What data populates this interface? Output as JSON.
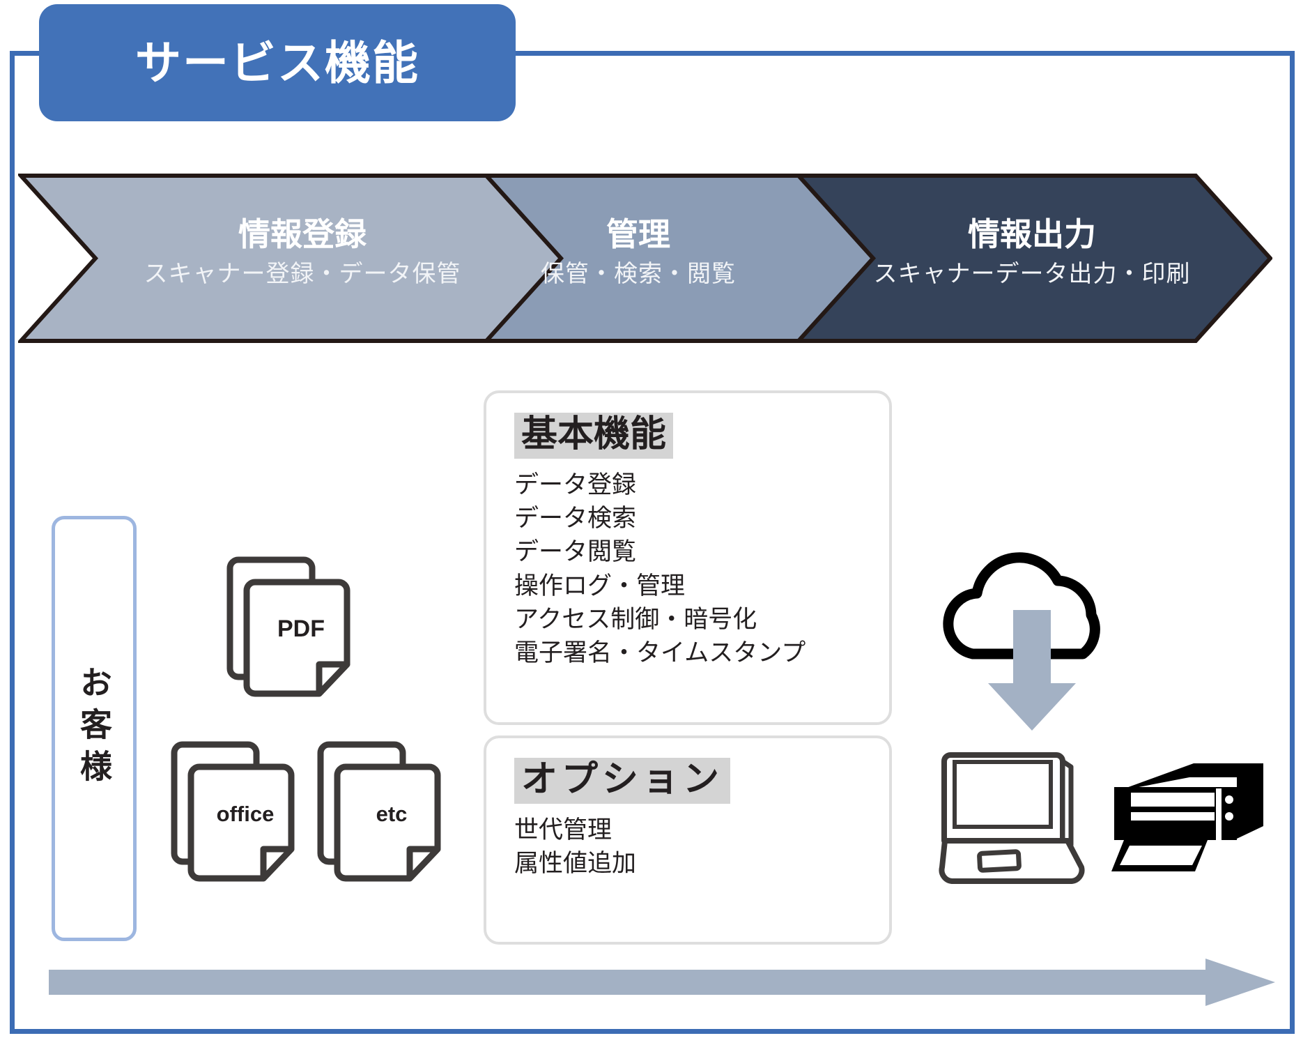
{
  "title_tab": {
    "label": "サービス機能"
  },
  "process_flow": {
    "steps": [
      {
        "title": "情報登録",
        "subtitle": "スキャナー登録・データ保管",
        "color": "#a8b3c4"
      },
      {
        "title": "管理",
        "subtitle": "保管・検索・閲覧",
        "color": "#8b9cb5"
      },
      {
        "title": "情報出力",
        "subtitle": "スキャナーデータ出力・印刷",
        "color": "#35435a"
      }
    ]
  },
  "customer": {
    "label": "お客様",
    "border_color": "#9db6e0"
  },
  "documents": [
    {
      "label": "PDF",
      "name": "pdf-document-icon",
      "font_size": 34
    },
    {
      "label": "office",
      "name": "office-document-icon",
      "font_size": 31
    },
    {
      "label": "etc",
      "name": "etc-document-icon",
      "font_size": 31
    }
  ],
  "panels": {
    "basic": {
      "heading": "基本機能",
      "items": [
        "データ登録",
        "データ検索",
        "データ閲覧",
        "操作ログ・管理",
        "アクセス制御・暗号化",
        "電子署名・タイムスタンプ"
      ]
    },
    "option": {
      "heading": "オプション",
      "items": [
        "世代管理",
        "属性値追加"
      ]
    }
  },
  "output_icons": [
    {
      "name": "cloud-download-icon"
    },
    {
      "name": "laptop-icon"
    },
    {
      "name": "printer-icon"
    }
  ],
  "colors": {
    "brand_blue": "#4272b8",
    "frame_blue": "#3c6cb4",
    "arrow_gray": "#a3b1c4",
    "heading_highlight": "#d4d4d4",
    "outline_dark": "#3d3a39"
  }
}
